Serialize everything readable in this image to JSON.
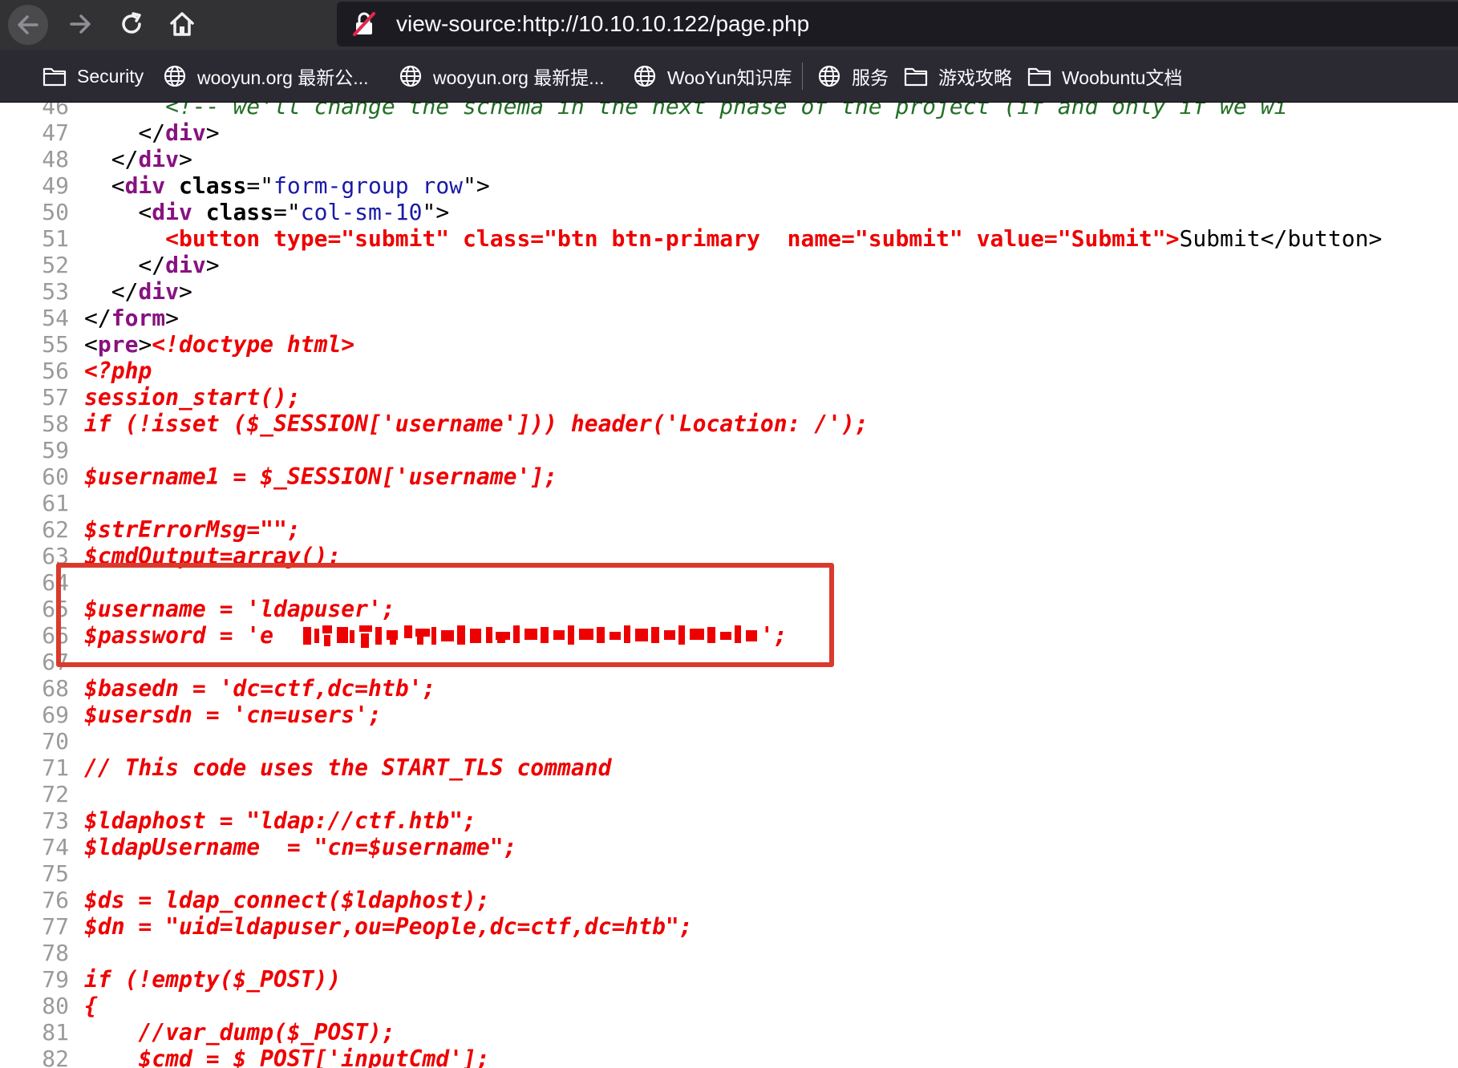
{
  "browser": {
    "url": "view-source:http://10.10.10.122/page.php",
    "icons": {
      "back": "arrow-left-icon",
      "forward": "arrow-right-icon",
      "reload": "reload-icon",
      "home": "home-icon",
      "insecure": "insecure-lock-icon"
    }
  },
  "bookmarks": [
    {
      "label": "Security",
      "icon": "folder-icon"
    },
    {
      "label": "wooyun.org 最新公...",
      "icon": "globe-icon"
    },
    {
      "label": "wooyun.org 最新提...",
      "icon": "globe-icon"
    },
    {
      "label": "WooYun知识库",
      "icon": "globe-icon"
    },
    {
      "label": "服务",
      "icon": "globe-icon"
    },
    {
      "label": "游戏攻略",
      "icon": "folder-icon"
    },
    {
      "label": "Woobuntu文档",
      "icon": "folder-icon"
    }
  ],
  "colors": {
    "toolbar": "#323234",
    "urlbar": "#1c1b22",
    "bookmarks_bar": "#2b2a33",
    "tag": "#881280",
    "attr_value": "#1a1aa6",
    "php": "#ee0000",
    "comment": "#236e25",
    "line_number": "#9a9a9a",
    "highlight_box": "#d93a2c"
  },
  "source": {
    "lines": [
      {
        "n": "46",
        "segments": [
          {
            "t": "      ",
            "c": "plain"
          },
          {
            "t": "<!-- we'll change the schema in the next phase of the project (if and only if we wi",
            "c": "cmt"
          }
        ]
      },
      {
        "n": "47",
        "segments": [
          {
            "t": "    </",
            "c": "plain"
          },
          {
            "t": "div",
            "c": "tag"
          },
          {
            "t": ">",
            "c": "plain"
          }
        ]
      },
      {
        "n": "48",
        "segments": [
          {
            "t": "  </",
            "c": "plain"
          },
          {
            "t": "div",
            "c": "tag"
          },
          {
            "t": ">",
            "c": "plain"
          }
        ]
      },
      {
        "n": "49",
        "segments": [
          {
            "t": "  <",
            "c": "plain"
          },
          {
            "t": "div",
            "c": "tag"
          },
          {
            "t": " ",
            "c": "plain"
          },
          {
            "t": "class",
            "c": "attr"
          },
          {
            "t": "=\"",
            "c": "plain"
          },
          {
            "t": "form-group row",
            "c": "val"
          },
          {
            "t": "\">",
            "c": "plain"
          }
        ]
      },
      {
        "n": "50",
        "segments": [
          {
            "t": "    <",
            "c": "plain"
          },
          {
            "t": "div",
            "c": "tag"
          },
          {
            "t": " ",
            "c": "plain"
          },
          {
            "t": "class",
            "c": "attr"
          },
          {
            "t": "=\"",
            "c": "plain"
          },
          {
            "t": "col-sm-10",
            "c": "val"
          },
          {
            "t": "\">",
            "c": "plain"
          }
        ]
      },
      {
        "n": "51",
        "segments": [
          {
            "t": "      ",
            "c": "plain"
          },
          {
            "t": "<button type=\"submit\" class=\"btn btn-primary  name=\"submit\" value=\"Submit\">",
            "c": "err"
          },
          {
            "t": "Submit</button>",
            "c": "plain"
          }
        ]
      },
      {
        "n": "52",
        "segments": [
          {
            "t": "    </",
            "c": "plain"
          },
          {
            "t": "div",
            "c": "tag"
          },
          {
            "t": ">",
            "c": "plain"
          }
        ]
      },
      {
        "n": "53",
        "segments": [
          {
            "t": "  </",
            "c": "plain"
          },
          {
            "t": "div",
            "c": "tag"
          },
          {
            "t": ">",
            "c": "plain"
          }
        ]
      },
      {
        "n": "54",
        "segments": [
          {
            "t": "</",
            "c": "plain"
          },
          {
            "t": "form",
            "c": "tag"
          },
          {
            "t": ">",
            "c": "plain"
          }
        ]
      },
      {
        "n": "55",
        "segments": [
          {
            "t": "<",
            "c": "plain"
          },
          {
            "t": "pre",
            "c": "tag"
          },
          {
            "t": ">",
            "c": "plain"
          },
          {
            "t": "<!doctype html>",
            "c": "php"
          }
        ]
      },
      {
        "n": "56",
        "segments": [
          {
            "t": "<?php",
            "c": "php"
          }
        ]
      },
      {
        "n": "57",
        "segments": [
          {
            "t": "session_start();",
            "c": "php"
          }
        ]
      },
      {
        "n": "58",
        "segments": [
          {
            "t": "if (!isset ($_SESSION['username'])) header('Location: /');",
            "c": "php"
          }
        ]
      },
      {
        "n": "59",
        "segments": []
      },
      {
        "n": "60",
        "segments": [
          {
            "t": "$username1 = $_SESSION['username'];",
            "c": "php"
          }
        ]
      },
      {
        "n": "61",
        "segments": []
      },
      {
        "n": "62",
        "segments": [
          {
            "t": "$strErrorMsg=\"\";",
            "c": "php"
          }
        ]
      },
      {
        "n": "63",
        "segments": [
          {
            "t": "$cmdOutput=array();",
            "c": "php"
          }
        ]
      },
      {
        "n": "64",
        "segments": []
      },
      {
        "n": "65",
        "segments": [
          {
            "t": "$username = 'ldapuser';",
            "c": "php"
          }
        ]
      },
      {
        "n": "66",
        "segments": [
          {
            "t": "$password = 'e",
            "c": "php"
          },
          {
            "t": "                                    ",
            "c": "plain"
          },
          {
            "t": "';",
            "c": "php"
          }
        ],
        "redacted": true
      },
      {
        "n": "67",
        "segments": []
      },
      {
        "n": "68",
        "segments": [
          {
            "t": "$basedn = 'dc=ctf,dc=htb';",
            "c": "php"
          }
        ]
      },
      {
        "n": "69",
        "segments": [
          {
            "t": "$usersdn = 'cn=users';",
            "c": "php"
          }
        ]
      },
      {
        "n": "70",
        "segments": []
      },
      {
        "n": "71",
        "segments": [
          {
            "t": "// This code uses the START_TLS command",
            "c": "php"
          }
        ]
      },
      {
        "n": "72",
        "segments": []
      },
      {
        "n": "73",
        "segments": [
          {
            "t": "$ldaphost = \"ldap://ctf.htb\";",
            "c": "php"
          }
        ]
      },
      {
        "n": "74",
        "segments": [
          {
            "t": "$ldapUsername  = \"cn=$username\";",
            "c": "php"
          }
        ]
      },
      {
        "n": "75",
        "segments": []
      },
      {
        "n": "76",
        "segments": [
          {
            "t": "$ds = ldap_connect($ldaphost);",
            "c": "php"
          }
        ]
      },
      {
        "n": "77",
        "segments": [
          {
            "t": "$dn = \"uid=ldapuser,ou=People,dc=ctf,dc=htb\";",
            "c": "php"
          }
        ]
      },
      {
        "n": "78",
        "segments": []
      },
      {
        "n": "79",
        "segments": [
          {
            "t": "if (!empty($_POST))",
            "c": "php"
          }
        ]
      },
      {
        "n": "80",
        "segments": [
          {
            "t": "{",
            "c": "php"
          }
        ]
      },
      {
        "n": "81",
        "segments": [
          {
            "t": "    //var_dump($_POST);",
            "c": "php"
          }
        ]
      },
      {
        "n": "82",
        "segments": [
          {
            "t": "    $cmd = $_POST['inputCmd'];",
            "c": "php"
          }
        ]
      }
    ]
  }
}
